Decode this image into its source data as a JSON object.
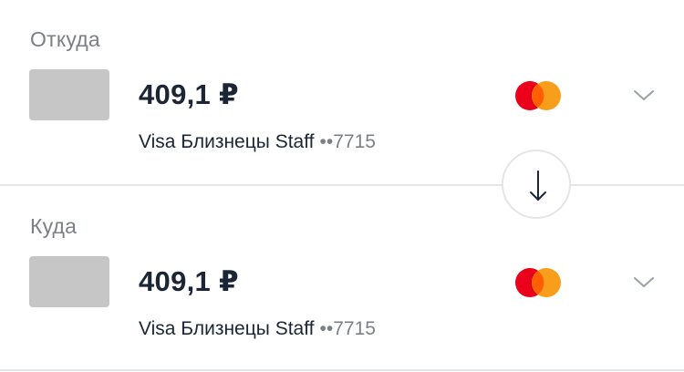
{
  "from": {
    "label": "Откуда",
    "amount": "409,1 ₽",
    "card_name": "Visa Близнецы Staff",
    "card_mask": "••7715",
    "brand_icon": "mastercard-logo",
    "chevron_icon": "chevron-down-icon"
  },
  "to": {
    "label": "Куда",
    "amount": "409,1 ₽",
    "card_name": "Visa Близнецы Staff",
    "card_mask": "••7715",
    "brand_icon": "mastercard-logo",
    "chevron_icon": "chevron-down-icon"
  },
  "swap": {
    "icon": "arrow-down-icon"
  },
  "colors": {
    "text_primary": "#1b2535",
    "text_secondary": "#7b7f86",
    "divider": "#e3e5e8",
    "thumb_placeholder": "#c6c6c6",
    "mastercard_red": "#eb001b",
    "mastercard_orange": "#f79e1b"
  }
}
